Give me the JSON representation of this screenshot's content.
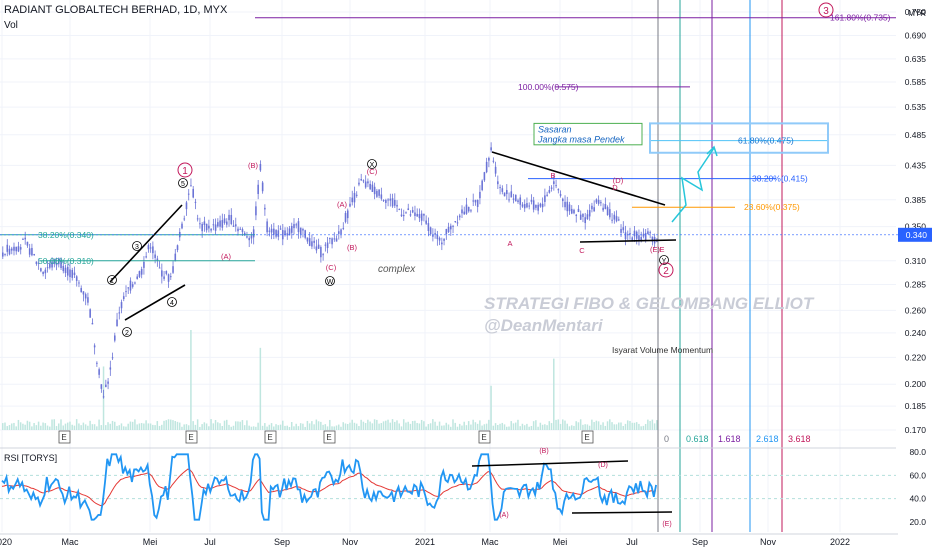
{
  "header": {
    "title": "RADIANT GLOBALTECH BERHAD, 1D, MYX",
    "vol_label": "Vol",
    "currency": "MYR"
  },
  "chart_data": {
    "type": "candlestick",
    "price_axis": {
      "ticks": [
        0.75,
        0.69,
        0.635,
        0.585,
        0.535,
        0.485,
        0.435,
        0.385,
        0.35,
        0.31,
        0.285,
        0.26,
        0.24,
        0.22,
        0.2,
        0.185,
        0.17
      ],
      "tick_labels": [
        "0.750",
        "0.690",
        "0.635",
        "0.585",
        "0.535",
        "0.485",
        "0.435",
        "0.385",
        "0.350",
        "0.310",
        "0.285",
        "0.260",
        "0.240",
        "0.220",
        "0.200",
        "0.185",
        "0.170"
      ],
      "last_price_label": "0.340",
      "scale": "log"
    },
    "x_axis": {
      "tick_labels": [
        "2020",
        "Mac",
        "Mei",
        "Jul",
        "Sep",
        "Nov",
        "2021",
        "Mac",
        "Mei",
        "Jul",
        "Sep",
        "Nov",
        "2022"
      ]
    },
    "last_price": 0.34,
    "fibonacci_levels": [
      {
        "label": "161.80%(0.735)",
        "value": 0.735
      },
      {
        "label": "100.00%(0.575)",
        "value": 0.575
      },
      {
        "label": "61.80%(0.475)",
        "value": 0.475
      },
      {
        "label": "38.20%(0.415)",
        "value": 0.415
      },
      {
        "label": "23.60%(0.375)",
        "value": 0.375
      },
      {
        "label": "38.20%(0.340)",
        "value": 0.34
      },
      {
        "label": "50.00%(0.310)",
        "value": 0.31
      }
    ],
    "target_box": {
      "line1": "Sasaran",
      "line2": "Jangka masa Pendek"
    },
    "wave_labels_circled": [
      "1",
      "2",
      "3",
      "4",
      "5",
      "X",
      "W",
      "Y"
    ],
    "wave_labels_major": [
      "1",
      "2",
      "3"
    ],
    "wave_labels_parenthetical": [
      "(A)",
      "(B)",
      "(C)",
      "(D)",
      "(E)",
      "(A)",
      "(B)",
      "(C)"
    ],
    "wave_labels_plain": [
      "A",
      "B",
      "C",
      "D",
      "E"
    ],
    "annotations": {
      "complex": "complex",
      "volume_momentum": "Isyarat Volume Momentum",
      "watermark_line1": "STRATEGI FIBO & GELOMBANG ELLIOT",
      "watermark_line2": "@DeanMentari"
    },
    "fib_time_zones": [
      {
        "label": "0",
        "color": "#787b86"
      },
      {
        "label": "0.618",
        "color": "#26a69a"
      },
      {
        "label": "1.618",
        "color": "#7b1fa2"
      },
      {
        "label": "2.618",
        "color": "#2196f3"
      },
      {
        "label": "3.618",
        "color": "#c2185b"
      }
    ],
    "earnings_marker": "E",
    "rsi": {
      "label": "RSI [TORYS]",
      "ticks": [
        80.0,
        60.0,
        40.0,
        20.0
      ],
      "tick_labels": [
        "80.0",
        "60.0",
        "40.0",
        "20.0"
      ],
      "labels": [
        "(B)",
        "(A)",
        "(D)",
        "(E)"
      ]
    },
    "colors": {
      "candle": "#6a73d6",
      "rsi_line": "#2196f3",
      "rsi_avg": "#e53935",
      "target_box": "#90caf9",
      "trendline": "#000000",
      "wave_label": "#c2185b",
      "fib_blue": "#2962ff",
      "fib_orange": "#ff9800",
      "fib_purple": "#7b1fa2"
    }
  }
}
